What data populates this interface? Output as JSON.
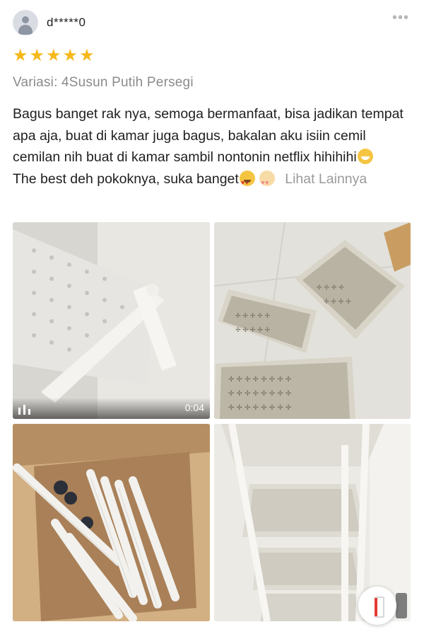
{
  "review": {
    "username": "d*****0",
    "more_icon": "more-dots-icon",
    "rating": 5,
    "stars_text": "★★★★★",
    "variant": "Variasi: 4Susun Putih Persegi",
    "text_line_main": "Bagus banget rak nya, semoga bermanfaat, bisa jadikan tempat apa aja, buat di kamar juga bagus, bakalan aku isiin cemil cemilan nih buat di kamar sambil nontonin netflix hihihihi",
    "text_line_second": "The best deh pokoknya, suka banget",
    "see_more": "Lihat Lainnya"
  },
  "media": {
    "video_duration": "0:04",
    "photo_labels": [
      "video-thumbnail",
      "photo-trays",
      "photo-box",
      "photo-rack"
    ]
  },
  "colors": {
    "star": "#f6b91c",
    "muted": "#8b8b8b",
    "link": "#9a9a9a"
  }
}
